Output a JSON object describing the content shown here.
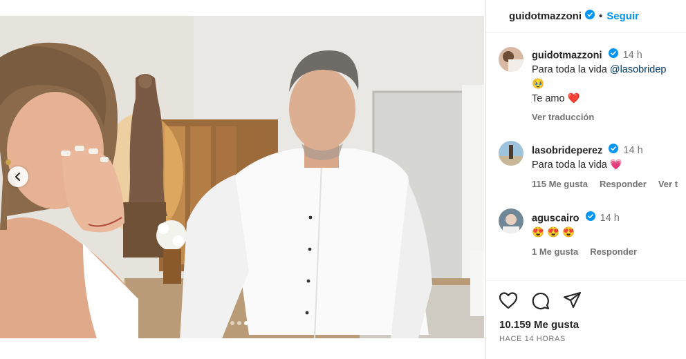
{
  "post": {
    "username": "guidotmazzoni",
    "separator": "•",
    "follow_label": "Seguir",
    "carousel_dots": 3,
    "active_dot": 2
  },
  "comments": [
    {
      "username": "guidotmazzoni",
      "time": "14 h",
      "text_prefix": "Para toda la vida ",
      "mention": "@lasobridep",
      "text_line2": "🥹",
      "text_line3_text": "Te amo ",
      "text_line3_emoji": "❤️",
      "link": "Ver traducción"
    },
    {
      "username": "lasobrideperez",
      "time": "14 h",
      "text": "Para toda la vida ",
      "emoji": "💗",
      "likes": "115 Me gusta",
      "reply": "Responder",
      "more": "Ver t"
    },
    {
      "username": "aguscairo",
      "time": "14 h",
      "text": "😍 😍 😍",
      "likes": "1 Me gusta",
      "reply": "Responder"
    }
  ],
  "footer": {
    "likes": "10.159 Me gusta",
    "when": "HACE 14 HORAS"
  },
  "colors": {
    "accent": "#0095f6",
    "verified": "#0095f6",
    "muted": "#737373"
  }
}
